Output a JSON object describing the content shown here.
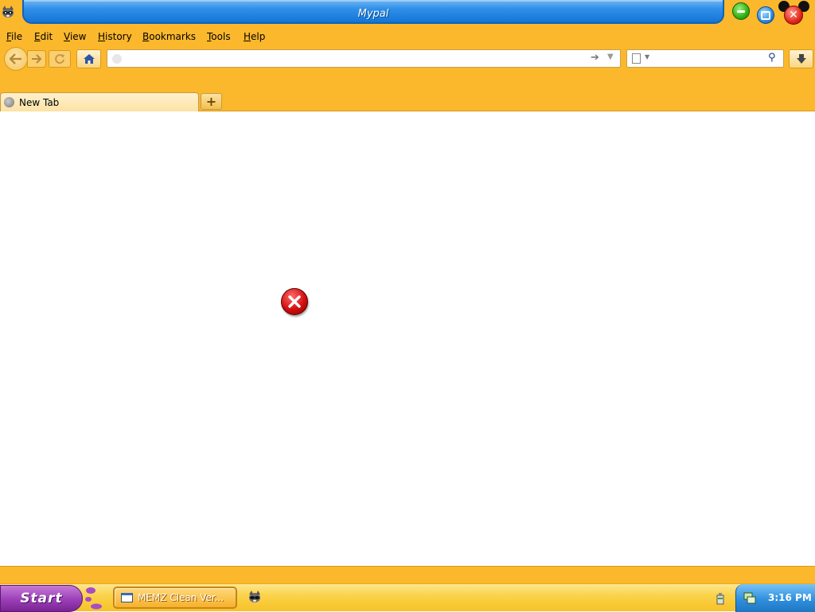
{
  "window": {
    "title": "Mypal"
  },
  "menu": {
    "items": [
      {
        "label": "File",
        "accel": "F",
        "rest": "ile"
      },
      {
        "label": "Edit",
        "accel": "E",
        "rest": "dit"
      },
      {
        "label": "View",
        "accel": "V",
        "rest": "iew"
      },
      {
        "label": "History",
        "accel": "H",
        "rest": "istory"
      },
      {
        "label": "Bookmarks",
        "accel": "B",
        "rest": "ookmarks"
      },
      {
        "label": "Tools",
        "accel": "T",
        "rest": "ools"
      },
      {
        "label": "Help",
        "accel": "H",
        "rest": "elp"
      }
    ]
  },
  "navbar": {
    "url_value": "",
    "search_value": ""
  },
  "tabs": [
    {
      "label": "New Tab",
      "active": true
    }
  ],
  "content": {
    "icon": "error-x-icon"
  },
  "taskbar": {
    "start_label": "Start",
    "task_label": "MEMZ Clean Ver...",
    "clock": "3:16 PM"
  },
  "colors": {
    "frame": "#fbb82c",
    "titlebar_blue": "#1475d6",
    "start_purple": "#9b3fb7",
    "error_red": "#d10f0f"
  }
}
